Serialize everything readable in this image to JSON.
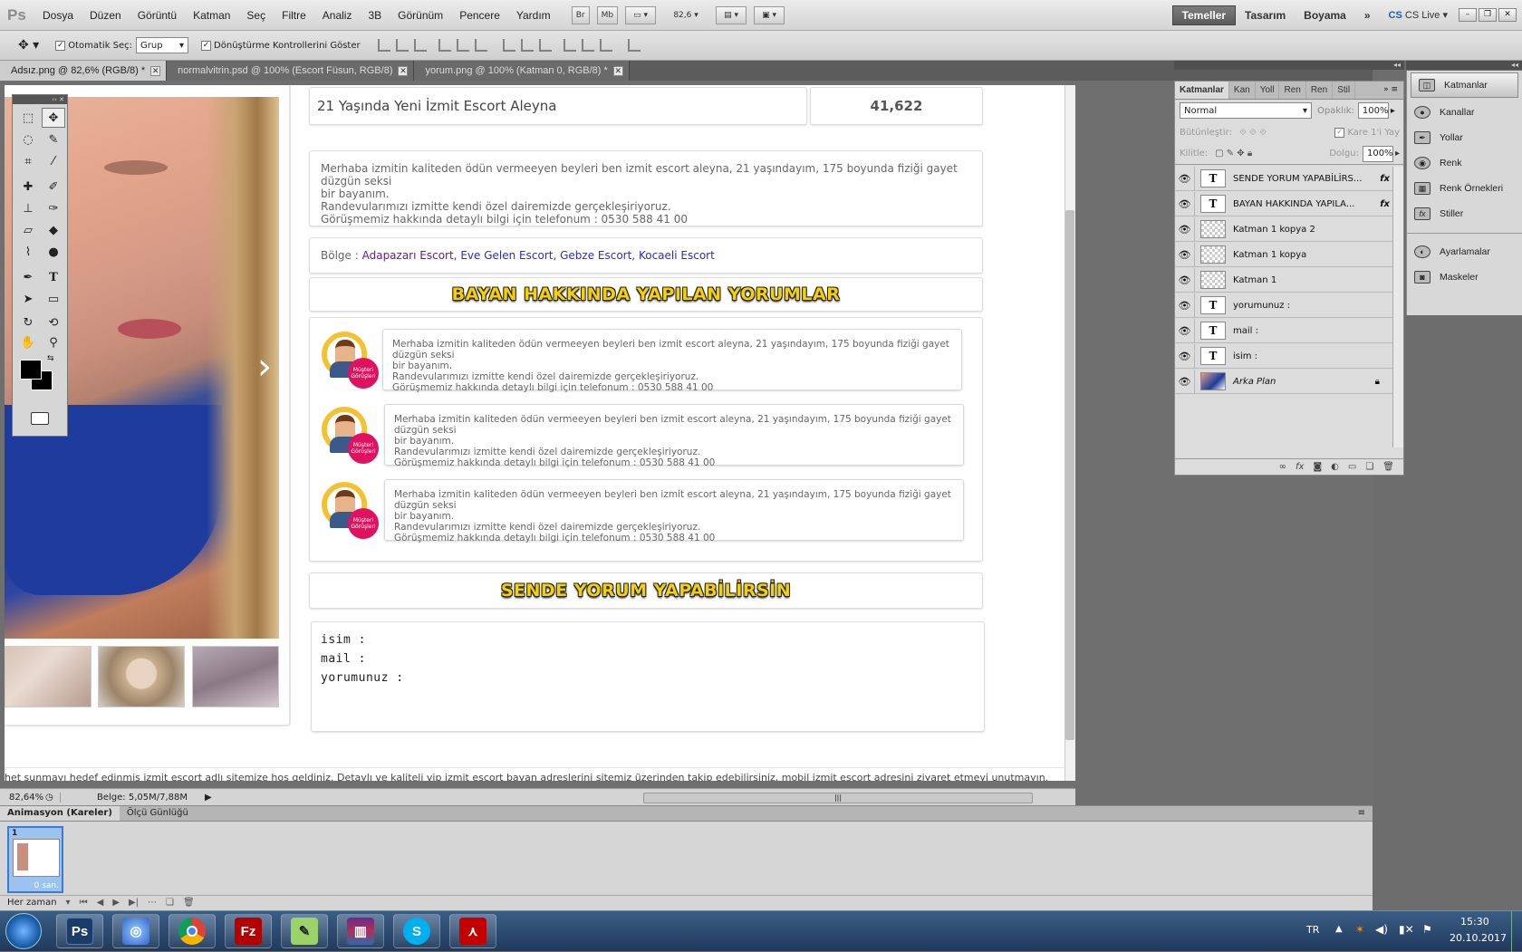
{
  "app": {
    "logo": "Ps"
  },
  "menu": [
    "Dosya",
    "Düzen",
    "Görüntü",
    "Katman",
    "Seç",
    "Filtre",
    "Analiz",
    "3B",
    "Görünüm",
    "Pencere",
    "Yardım"
  ],
  "menubar": {
    "br": "Br",
    "mb": "Mb",
    "zoom": "82,6"
  },
  "workspaces": {
    "active": "Temeller",
    "items": [
      "Tasarım",
      "Boyama"
    ],
    "more": "»",
    "cslive": "CS Live"
  },
  "options": {
    "auto_select_label": "Otomatik Seç:",
    "auto_select_value": "Grup",
    "transform_label": "Dönüştürme Kontrollerini Göster"
  },
  "tabs": [
    {
      "label": "Adsız.png @ 82,6% (RGB/8) *"
    },
    {
      "label": "normalvitrin.psd @ 100% (Escort Füsun, RGB/8)"
    },
    {
      "label": "yorum.png @ 100% (Katman 0, RGB/8) *"
    }
  ],
  "page": {
    "title": "21 Yaşında Yeni İzmit Escort Aleyna",
    "views": "41,622",
    "desc_lines": [
      "Merhaba izmitin kaliteden ödün vermeeyen beyleri ben izmit escort aleyna, 21 yaşındayım, 175 boyunda fiziği gayet düzgün seksi",
      "bir bayanım.",
      "Randevularımızı izmitte kendi özel dairemizde gerçekleşiriyoruz.",
      "Görüşmemiz hakkında detaylı bilgi için telefonum : 0530 588 41 00"
    ],
    "region_label": "Bölge :",
    "region_links": [
      "Adapazarı Escort,",
      "Eve Gelen Escort,",
      "Gebze Escort,",
      "Kocaeli Escort"
    ],
    "comments_heading": "BAYAN HAKKINDA YAPILAN YORUMLAR",
    "comment_lines": [
      "Merhaba izmitin kaliteden ödün vermeeyen beyleri ben izmit escort aleyna, 21 yaşındayım, 175 boyunda fiziği gayet düzgün seksi",
      "bir bayanım.",
      "Randevularımızı izmitte kendi özel dairemizde gerçekleşiriyoruz.",
      "Görüşmemiz hakkında detaylı bilgi için telefonum : 0530 588 41 00"
    ],
    "badge_text": "Müşteri Görüşleri",
    "form_heading": "SENDE YORUM YAPABİLİRSİN",
    "form_name": "isim :",
    "form_mail": "mail :",
    "form_comment": "yorumunuz :",
    "footer": "het sunmayı hedef edinmiş izmit escort adlı sitemize hoş geldiniz. Detaylı ve kaliteli vip izmit escort bayan adreslerini sitemiz üzerinden takip edebilirsiniz, mobil izmit escort adresini ziyaret etmeyi unutmayın."
  },
  "status": {
    "zoom": "82,64%",
    "doc": "Belge: 5,05M/7,88M"
  },
  "layers_panel": {
    "tabs": [
      "Katmanlar",
      "Kan",
      "Yoll",
      "Ren",
      "Ren",
      "Stil"
    ],
    "blend": "Normal",
    "opacity_label": "Opaklık:",
    "opacity": "100%",
    "unify_label": "Bütünleştir:",
    "frame_label": "Kare 1'i Yay",
    "lock_label": "Kilitle:",
    "fill_label": "Dolgu:",
    "fill": "100%",
    "layers": [
      {
        "name": "SENDE YORUM YAPABİLİRS...",
        "type": "T",
        "fx": "fx"
      },
      {
        "name": "BAYAN HAKKINDA YAPILA...",
        "type": "T",
        "fx": "fx"
      },
      {
        "name": "Katman 1 kopya 2",
        "type": "pixel",
        "fx": ""
      },
      {
        "name": "Katman 1 kopya",
        "type": "pixel",
        "fx": ""
      },
      {
        "name": "Katman 1",
        "type": "pixel",
        "fx": ""
      },
      {
        "name": "yorumunuz :",
        "type": "T",
        "fx": ""
      },
      {
        "name": "mail :",
        "type": "T",
        "fx": ""
      },
      {
        "name": "isim :",
        "type": "T",
        "fx": ""
      },
      {
        "name": "Arka Plan",
        "type": "bg",
        "fx": ""
      }
    ]
  },
  "dock": {
    "group1": [
      "Katmanlar",
      "Kanallar",
      "Yollar",
      "Renk",
      "Renk Örnekleri",
      "Stiller"
    ],
    "group2": [
      "Ayarlamalar",
      "Maskeler"
    ]
  },
  "anim": {
    "tabs": [
      "Animasyon (Kareler)",
      "Ölçü Günlüğü"
    ],
    "frame_no": "1",
    "frame_time": "0 san.",
    "loop": "Her zaman"
  },
  "taskbar": {
    "lang": "TR",
    "time": "15:30",
    "date": "20.10.2017",
    "ps_label": "Ps"
  },
  "colors": {
    "accent_yellow": "#f5d100",
    "link_blue": "#2a2acc",
    "ps_blue": "#1a5ea8"
  }
}
